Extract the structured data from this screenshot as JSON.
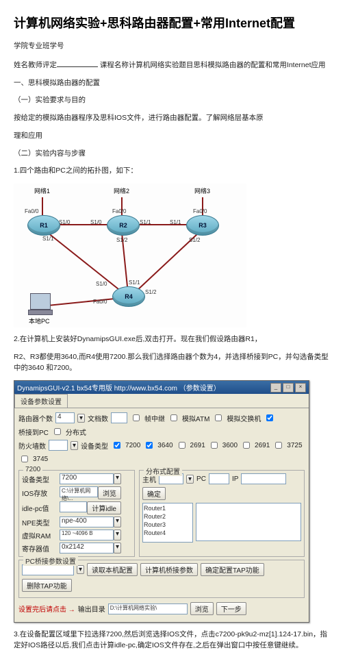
{
  "title": "计算机网络实验+思科路由器配置+常用Internet配置",
  "lines": {
    "l1": "学院专业班学号",
    "l2a": "姓名教师评定",
    "l2b": " 课程名称计算机网络实验题目思科模拟路由器的配置和常用Internet应用",
    "l3": "一、思科模拟路由器的配置",
    "l4": "（一）实验要求与目的",
    "l5": "按给定的模拟路由器程序及思科IOS文件，进行路由器配置。了解网络层基本原",
    "l6": "理和应用",
    "l7": "（二）实验内容与步骤",
    "l8": "1.四个路由和PC之间的拓扑图，如下：",
    "l9": "2.在计算机上安装好DynamipsGUI.exe后,双击打开。现在我们假设路由器R1，",
    "l10": "R2、R3都使用3640,而R4使用7200.那么我们选择路由器个数为4，并选择桥接到PC，并勾选备类型中的3640 和7200。",
    "l11": "3.在设备配置区域里下拉选择7200,然后浏览选择IOS文件，点击c7200-pk9u2-mz[1].124-17.bin，指定好IOS路径以后,我们点击计算idle-pc,确定IOS文件存在,之后在弹出窗口中按任意键继续。"
  },
  "topo": {
    "net1": "网络1",
    "net2": "网络2",
    "net3": "网络3",
    "r1": "R1",
    "r2": "R2",
    "r3": "R3",
    "r4": "R4",
    "pc": "本地PC",
    "ports": {
      "r1fa00": "Fa0/0",
      "r1s10": "S1/0",
      "r1s11": "S1/1",
      "r2fa00": "Fa0/0",
      "r2s10": "S1/0",
      "r2s11": "S1/1",
      "r2s12": "S1/2",
      "r3fa00": "Fa0/0",
      "r3s11": "S1/1",
      "r3s12": "S1/2",
      "r4fa00": "Fa0/0",
      "r4s10": "S1/0",
      "r4s11": "S1/1",
      "r4s12": "S1/2"
    }
  },
  "gui": {
    "title": "DynamipsGUI-v2.1  bx54专用版 http://www.bx54.com  （参数设置）",
    "tab1": "设备参数设置",
    "row1": {
      "label": "路由器个数",
      "val": "4",
      "arrow": "▾",
      "cb_frelay": "帧中继",
      "cb_atm": "模拟ATM",
      "cb_sw": "模拟交换机",
      "cb_bridge": "桥接到PC",
      "cb_dist": "分布式"
    },
    "row2": {
      "label": "防火墙数",
      "val": "",
      "arrow": "▾",
      "typelabel": "设备类型",
      "cb7200": "7200",
      "cb3640": "3640",
      "cb2691": "2691",
      "cb3600": "3600",
      "cb2691b": "2691",
      "cb3725": "3725",
      "cb3745": "3745"
    },
    "leftGroup": {
      "title": "7200",
      "devtype": "设备类型",
      "devtype_v": "7200",
      "devtype_ar": "▾",
      "ios": "IOS存放",
      "ios_v": "C:\\计算机网络\\...",
      "browse": "浏览",
      "idle": "idle-pc值",
      "idle_v": "",
      "calc": "计算idle",
      "npe": "NPE类型",
      "npe_v": "npe-400",
      "npe_ar": "▾",
      "vram": "虚拟RAM",
      "vram_v": "120 ~4096 B",
      "vram_ar": "▾",
      "conf": "寄存器值",
      "conf_v": "0x2142",
      "conf_ar": "▾"
    },
    "midGroup": {
      "title": "分布式配置",
      "host": "主机",
      "arrow": "▾",
      "pclbl": "PC",
      "iplbl": "IP",
      "confirm": "确定",
      "listtitle": "Router1\nRouter2\nRouter3\nRouter4",
      "list": [
        "Router1",
        "Router2",
        "Router3",
        "Router4"
      ]
    },
    "bottom": {
      "label": "PC桥接参数设置",
      "read": "读取本机配置",
      "calc": "计算机桥接参数",
      "conftap": "确定配置TAP功能",
      "deltap": "删除TAP功能",
      "arrow": "▾"
    },
    "footer": {
      "setup": "设置完后请点击 →",
      "out": "输出目录",
      "outv": "D:\\计算机网络实验\\",
      "browse": "浏览",
      "next": "下一步"
    }
  }
}
